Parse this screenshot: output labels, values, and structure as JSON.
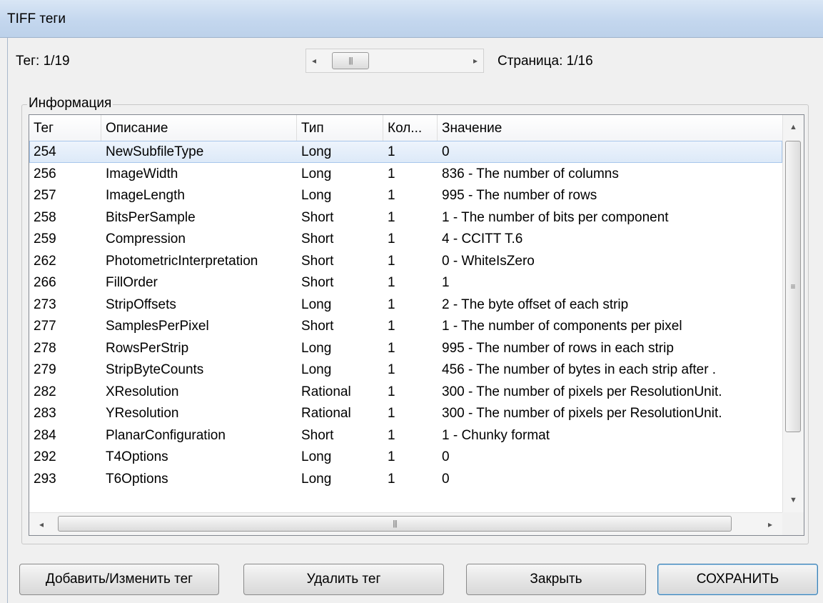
{
  "window": {
    "title": "TIFF теги"
  },
  "nav": {
    "tag_counter": "Тег: 1/19",
    "page_counter": "Страница: 1/16"
  },
  "info": {
    "group_label": "Информация",
    "columns": [
      "Тег",
      "Описание",
      "Тип",
      "Кол...",
      "Значение"
    ],
    "rows": [
      [
        "254",
        "NewSubfileType",
        "Long",
        "1",
        "0"
      ],
      [
        "256",
        "ImageWidth",
        "Long",
        "1",
        "836 - The number of columns"
      ],
      [
        "257",
        "ImageLength",
        "Long",
        "1",
        "995 - The number of rows"
      ],
      [
        "258",
        "BitsPerSample",
        "Short",
        "1",
        "1 - The number of bits per component"
      ],
      [
        "259",
        "Compression",
        "Short",
        "1",
        "4 - CCITT T.6"
      ],
      [
        "262",
        "PhotometricInterpretation",
        "Short",
        "1",
        "0 - WhiteIsZero"
      ],
      [
        "266",
        "FillOrder",
        "Short",
        "1",
        "1"
      ],
      [
        "273",
        "StripOffsets",
        "Long",
        "1",
        "2 - The byte offset of each strip"
      ],
      [
        "277",
        "SamplesPerPixel",
        "Short",
        "1",
        "1 - The number of components per pixel"
      ],
      [
        "278",
        "RowsPerStrip",
        "Long",
        "1",
        "995 - The number of rows in each strip"
      ],
      [
        "279",
        "StripByteCounts",
        "Long",
        "1",
        "456 - The number of bytes in each strip after ."
      ],
      [
        "282",
        "XResolution",
        "Rational",
        "1",
        "300 - The number of pixels per ResolutionUnit."
      ],
      [
        "283",
        "YResolution",
        "Rational",
        "1",
        "300 - The number of pixels per ResolutionUnit."
      ],
      [
        "284",
        "PlanarConfiguration",
        "Short",
        "1",
        "1 - Chunky format"
      ],
      [
        "292",
        "T4Options",
        "Long",
        "1",
        "0"
      ],
      [
        "293",
        "T6Options",
        "Long",
        "1",
        "0"
      ]
    ]
  },
  "buttons": {
    "add_edit": "Добавить/Изменить тег",
    "delete": "Удалить тег",
    "close": "Закрыть",
    "save": "СОХРАНИТЬ"
  }
}
